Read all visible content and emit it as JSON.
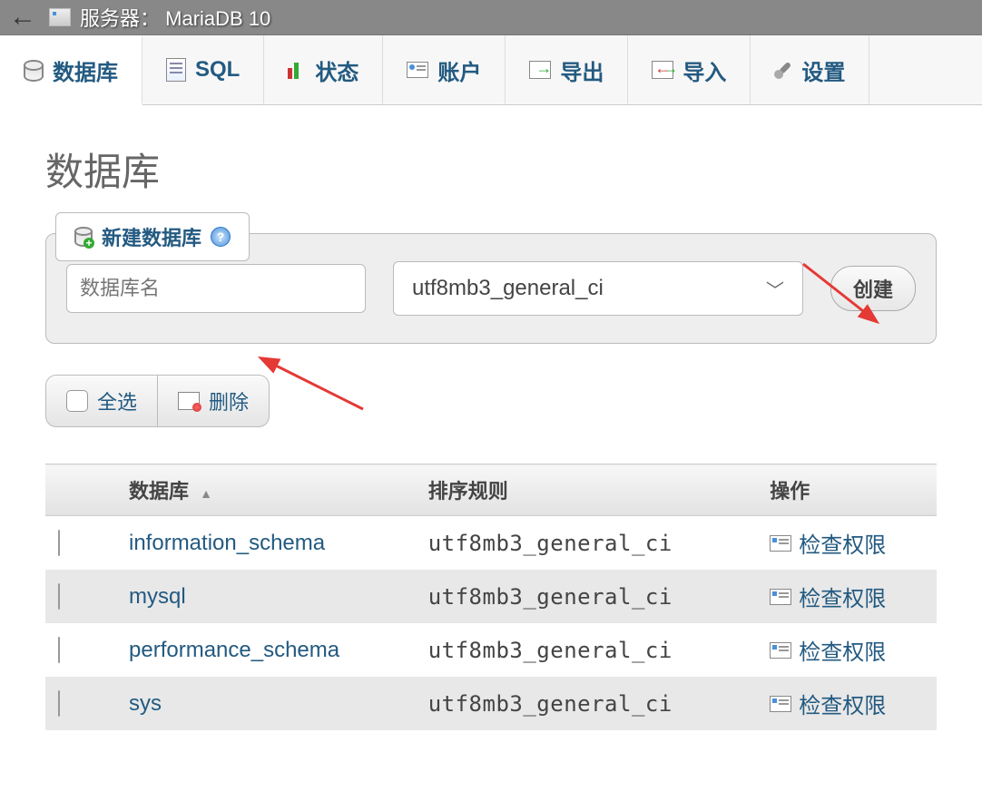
{
  "server_bar": {
    "label": "服务器：",
    "name": "MariaDB 10"
  },
  "tabs": [
    {
      "label": "数据库"
    },
    {
      "label": "SQL"
    },
    {
      "label": "状态"
    },
    {
      "label": "账户"
    },
    {
      "label": "导出"
    },
    {
      "label": "导入"
    },
    {
      "label": "设置"
    }
  ],
  "page": {
    "title": "数据库",
    "create_legend": "新建数据库",
    "dbname_placeholder": "数据库名",
    "collation_selected": "utf8mb3_general_ci",
    "create_button": "创建"
  },
  "actions": {
    "select_all": "全选",
    "delete": "删除"
  },
  "table": {
    "headers": {
      "db": "数据库",
      "collation": "排序规则",
      "ops": "操作"
    },
    "priv_label": "检查权限",
    "rows": [
      {
        "name": "information_schema",
        "collation": "utf8mb3_general_ci"
      },
      {
        "name": "mysql",
        "collation": "utf8mb3_general_ci"
      },
      {
        "name": "performance_schema",
        "collation": "utf8mb3_general_ci"
      },
      {
        "name": "sys",
        "collation": "utf8mb3_general_ci"
      }
    ]
  }
}
